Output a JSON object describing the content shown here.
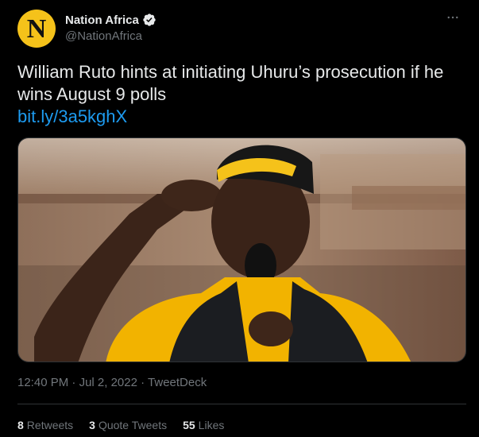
{
  "author": {
    "display_name": "Nation Africa",
    "handle": "@NationAfrica",
    "avatar_letter": "N",
    "avatar_color": "#f5c21a",
    "verified": true
  },
  "tweet": {
    "text": "William Ruto hints at initiating Uhuru’s prosecution if he wins August 9 polls",
    "link": "bit.ly/3a5kghX",
    "image_description": "Man in yellow cap and shirt with black vest speaking into microphone, saluting"
  },
  "meta": {
    "time": "12:40 PM",
    "date": "Jul 2, 2022",
    "source": "TweetDeck",
    "separator": "·"
  },
  "stats": {
    "retweets_count": "8",
    "retweets_label": "Retweets",
    "quotes_count": "3",
    "quotes_label": "Quote Tweets",
    "likes_count": "55",
    "likes_label": "Likes"
  },
  "colors": {
    "background": "#000000",
    "text": "#e7e9ea",
    "muted": "#71767b",
    "link": "#1d9bf0",
    "verified": "#e7e9ea"
  },
  "icons": {
    "more": "more-horizontal-icon",
    "verified": "verified-badge-icon"
  }
}
